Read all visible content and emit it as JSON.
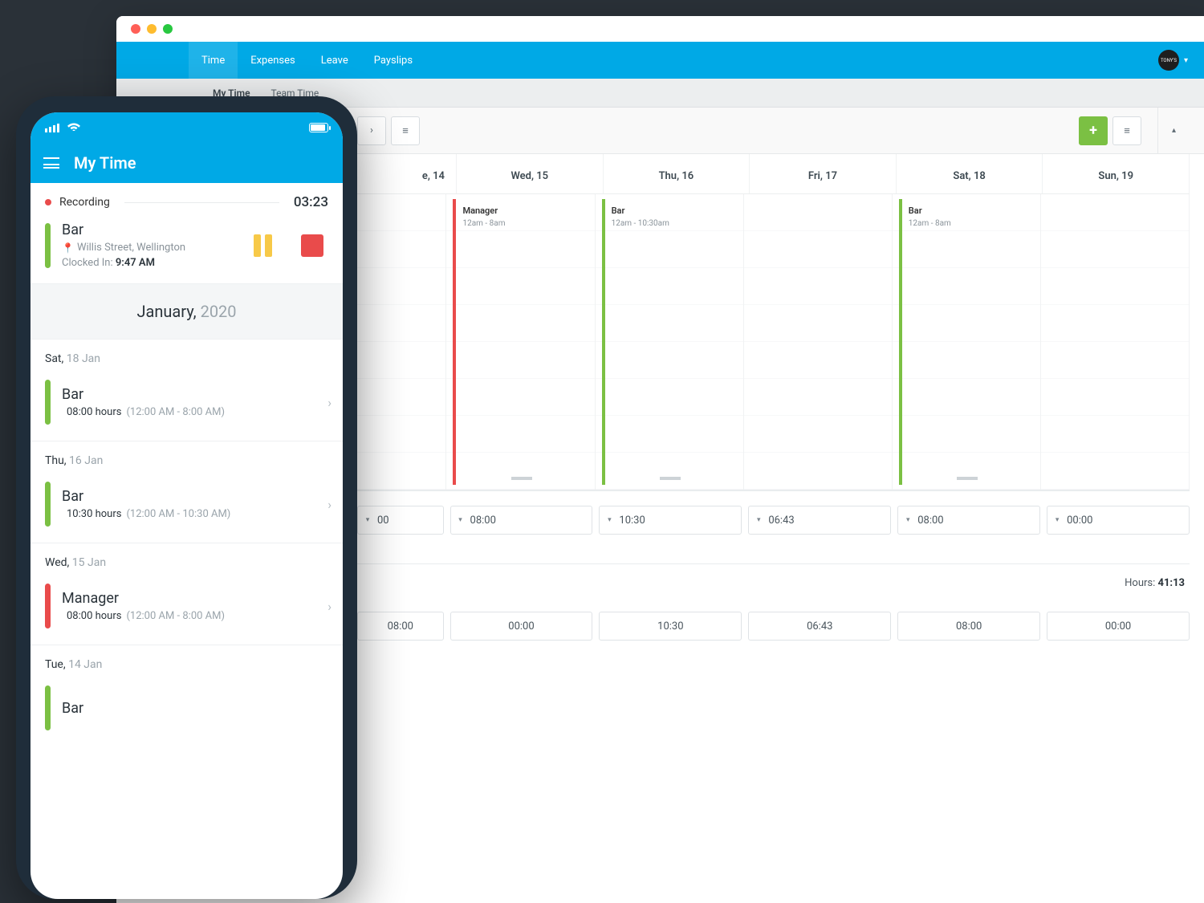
{
  "desktop": {
    "topnav": {
      "tabs": [
        "Time",
        "Expenses",
        "Leave",
        "Payslips"
      ],
      "active": 0,
      "avatar_label": "TONY'S"
    },
    "subnav": {
      "tabs": [
        "My Time",
        "Team Time"
      ],
      "active": 0
    },
    "controls": {
      "next": "›",
      "list": "≡",
      "plus": "+",
      "grid": "≡",
      "caret": "▴"
    },
    "calendar": {
      "days": [
        "e, 14",
        "Wed, 15",
        "Thu, 16",
        "Fri, 17",
        "Sat, 18",
        "Sun, 19"
      ],
      "events": {
        "wed": {
          "title": "Manager",
          "range": "12am - 8am",
          "color": "red"
        },
        "thu": {
          "title": "Bar",
          "range": "12am - 10:30am",
          "color": "green"
        },
        "sat": {
          "title": "Bar",
          "range": "12am - 8am",
          "color": "green"
        }
      }
    },
    "hours_top": [
      "00",
      "08:00",
      "10:30",
      "06:43",
      "08:00",
      "00:00"
    ],
    "hours_bot": [
      "08:00",
      "00:00",
      "10:30",
      "06:43",
      "08:00",
      "00:00"
    ],
    "total_label": "Hours:",
    "total_value": "41:13"
  },
  "phone": {
    "title": "My Time",
    "recording": {
      "label": "Recording",
      "elapsed": "03:23"
    },
    "current": {
      "title": "Bar",
      "address": "Willis Street, Wellington",
      "clockin_label": "Clocked In:",
      "clockin_time": "9:47 AM"
    },
    "month": {
      "name": "January,",
      "year": "2020"
    },
    "entries": [
      {
        "day": "Sat,",
        "date": "18 Jan",
        "title": "Bar",
        "hours": "08:00 hours",
        "range": "(12:00 AM - 8:00 AM)",
        "color": "green"
      },
      {
        "day": "Thu,",
        "date": "16 Jan",
        "title": "Bar",
        "hours": "10:30 hours",
        "range": "(12:00 AM - 10:30 AM)",
        "color": "green"
      },
      {
        "day": "Wed,",
        "date": "15 Jan",
        "title": "Manager",
        "hours": "08:00 hours",
        "range": "(12:00 AM - 8:00 AM)",
        "color": "red"
      },
      {
        "day": "Tue,",
        "date": "14 Jan",
        "title": "Bar",
        "hours": "",
        "range": "",
        "color": "green"
      }
    ]
  }
}
